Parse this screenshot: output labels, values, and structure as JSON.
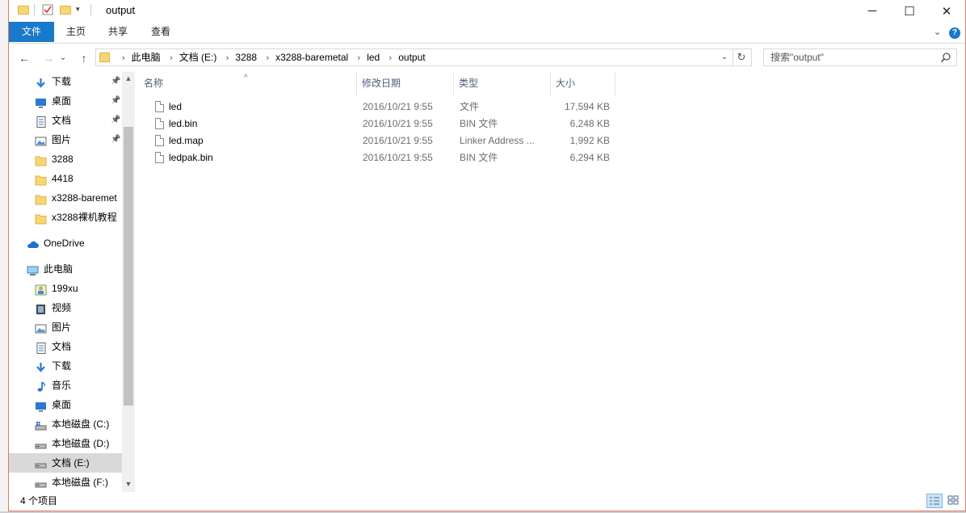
{
  "window": {
    "title": "output",
    "minimize_label": "─",
    "maximize_label": "☐",
    "close_label": "✕"
  },
  "ribbon": {
    "tabs": [
      "文件",
      "主页",
      "共享",
      "查看"
    ],
    "expand_label": "⌄"
  },
  "nav": {
    "back": "←",
    "forward": "→",
    "recent": "⌄",
    "up": "↑"
  },
  "address": {
    "breadcrumbs": [
      "此电脑",
      "文档 (E:)",
      "3288",
      "x3288-baremetal",
      "led",
      "output"
    ],
    "dropdown": "⌄",
    "refresh": "↻"
  },
  "search": {
    "placeholder": "搜索\"output\""
  },
  "navpane": {
    "items": [
      {
        "label": "下载",
        "icon": "download-arrow-icon",
        "pinned": true
      },
      {
        "label": "桌面",
        "icon": "desktop-icon",
        "pinned": true
      },
      {
        "label": "文档",
        "icon": "document-icon",
        "pinned": true
      },
      {
        "label": "图片",
        "icon": "picture-icon",
        "pinned": true
      },
      {
        "label": "3288",
        "icon": "folder-icon",
        "pinned": false
      },
      {
        "label": "4418",
        "icon": "folder-icon",
        "pinned": false
      },
      {
        "label": "x3288-baremet",
        "icon": "folder-icon",
        "pinned": false
      },
      {
        "label": "x3288裸机教程",
        "icon": "folder-icon",
        "pinned": false
      },
      {
        "label": "OneDrive",
        "icon": "cloud-icon",
        "pinned": false
      },
      {
        "label": "此电脑",
        "icon": "computer-icon",
        "pinned": false
      },
      {
        "label": "199xu",
        "icon": "user-network-icon",
        "pinned": false
      },
      {
        "label": "视频",
        "icon": "video-icon",
        "pinned": false
      },
      {
        "label": "图片",
        "icon": "picture-icon",
        "pinned": false
      },
      {
        "label": "文档",
        "icon": "document-icon",
        "pinned": false
      },
      {
        "label": "下载",
        "icon": "download-arrow-icon",
        "pinned": false
      },
      {
        "label": "音乐",
        "icon": "music-icon",
        "pinned": false
      },
      {
        "label": "桌面",
        "icon": "desktop-icon",
        "pinned": false
      },
      {
        "label": "本地磁盘 (C:)",
        "icon": "system-drive-icon",
        "pinned": false
      },
      {
        "label": "本地磁盘 (D:)",
        "icon": "drive-icon",
        "pinned": false
      },
      {
        "label": "文档 (E:)",
        "icon": "drive-icon",
        "pinned": false,
        "selected": true
      },
      {
        "label": "本地磁盘 (F:)",
        "icon": "drive-icon",
        "pinned": false
      }
    ]
  },
  "columns": {
    "name": "名称",
    "date": "修改日期",
    "type": "类型",
    "size": "大小"
  },
  "files": [
    {
      "name": "led",
      "date": "2016/10/21 9:55",
      "type": "文件",
      "size": "17,594 KB"
    },
    {
      "name": "led.bin",
      "date": "2016/10/21 9:55",
      "type": "BIN 文件",
      "size": "6,248 KB"
    },
    {
      "name": "led.map",
      "date": "2016/10/21 9:55",
      "type": "Linker Address ...",
      "size": "1,992 KB"
    },
    {
      "name": "ledpak.bin",
      "date": "2016/10/21 9:55",
      "type": "BIN 文件",
      "size": "6,294 KB"
    }
  ],
  "status": {
    "item_count": "4 个项目"
  },
  "colors": {
    "accent": "#1979ca",
    "folder": "#f7d674",
    "selected_bg": "#d9d9d9",
    "window_border": "#e07a5f"
  }
}
